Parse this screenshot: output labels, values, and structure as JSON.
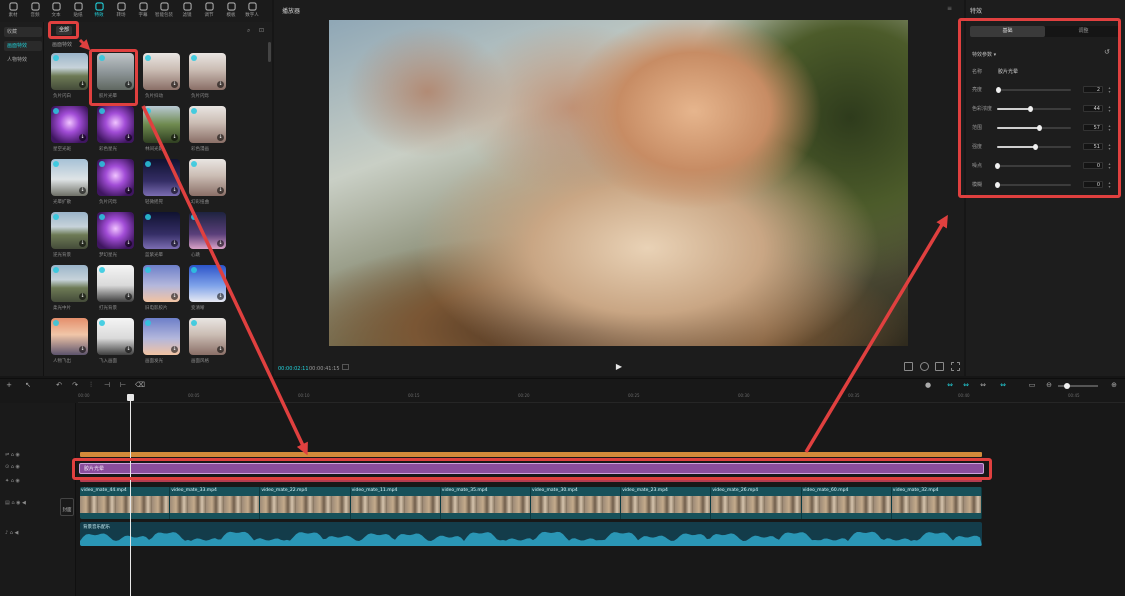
{
  "toolbar": {
    "tools": [
      {
        "label": "素材",
        "icon": "media-icon",
        "active": false
      },
      {
        "label": "音频",
        "icon": "audio-icon",
        "active": false
      },
      {
        "label": "文本",
        "icon": "text-icon",
        "active": false
      },
      {
        "label": "贴纸",
        "icon": "sticker-icon",
        "active": false
      },
      {
        "label": "特效",
        "icon": "effects-icon",
        "active": true
      },
      {
        "label": "转场",
        "icon": "transition-icon",
        "active": false
      },
      {
        "label": "字幕",
        "icon": "caption-icon",
        "active": false
      },
      {
        "label": "智能包装",
        "icon": "smart-pack-icon",
        "active": false
      },
      {
        "label": "滤镜",
        "icon": "filter-icon",
        "active": false
      },
      {
        "label": "调节",
        "icon": "adjust-icon",
        "active": false
      },
      {
        "label": "模板",
        "icon": "template-icon",
        "active": false
      },
      {
        "label": "数字人",
        "icon": "avatar-icon",
        "active": false
      }
    ]
  },
  "left_panel": {
    "categories": [
      "收藏",
      "画面特效",
      "人物特效"
    ],
    "filter_chip": "全部",
    "section_title": "画面特效",
    "items": [
      {
        "label": "负片闪白"
      },
      {
        "label": "胶片光晕"
      },
      {
        "label": "负片抖动"
      },
      {
        "label": "负片闪烁"
      },
      {
        "label": "星空光斑"
      },
      {
        "label": "彩色星光"
      },
      {
        "label": "林间光影"
      },
      {
        "label": "彩色漫画"
      },
      {
        "label": "光晕扩散"
      },
      {
        "label": "负片闪烁"
      },
      {
        "label": "轻微摇晃"
      },
      {
        "label": "幻彩扭曲"
      },
      {
        "label": "逆光背景"
      },
      {
        "label": "梦幻星光"
      },
      {
        "label": "蓝紫光晕"
      },
      {
        "label": "心跳"
      },
      {
        "label": "柔光中片"
      },
      {
        "label": "打光背景"
      },
      {
        "label": "旧电影胶片"
      },
      {
        "label": "变清晰"
      },
      {
        "label": "人物飞出"
      },
      {
        "label": "飞入画面"
      },
      {
        "label": "画面发光"
      },
      {
        "label": "画面风格"
      }
    ]
  },
  "player": {
    "title": "播放器",
    "timecode": "00:00:02:11",
    "duration": "00:00:41:15"
  },
  "right_panel": {
    "title": "特效",
    "tabs": [
      "基础",
      "调整"
    ],
    "param_header": "特效参数 ▾",
    "name_label": "名称",
    "name_value": "胶片光晕",
    "params": [
      {
        "label": "亮度",
        "value": 2
      },
      {
        "label": "色彩浓度",
        "value": 44
      },
      {
        "label": "范围",
        "value": 57
      },
      {
        "label": "强度",
        "value": 51
      },
      {
        "label": "噪点",
        "value": 0
      },
      {
        "label": "模糊",
        "value": 0
      }
    ]
  },
  "timeline": {
    "ruler": [
      "00:00",
      "00:05",
      "00:10",
      "00:15",
      "00:20",
      "00:25",
      "00:30",
      "00:35",
      "00:40",
      "00:45"
    ],
    "filter_track_label": "胶片光晕",
    "cover_label": "封面",
    "audio_label": "背景音乐配乐",
    "video_clips": [
      {
        "name": "video_mate_44.mp4"
      },
      {
        "name": "video_mate_33.mp4"
      },
      {
        "name": "video_mate_22.mp4"
      },
      {
        "name": "video_mate_11.mp4"
      },
      {
        "name": "video_mate_35.mp4"
      },
      {
        "name": "video_mate_30.mp4"
      },
      {
        "name": "video_mate_23.mp4"
      },
      {
        "name": "video_mate_26.mp4"
      },
      {
        "name": "video_mate_60.mp4"
      },
      {
        "name": "video_mate_32.mp4"
      }
    ]
  },
  "colors": {
    "accent": "#22d3dd",
    "annotation": "#e0403f",
    "filter_track": "#8a4d9c"
  }
}
